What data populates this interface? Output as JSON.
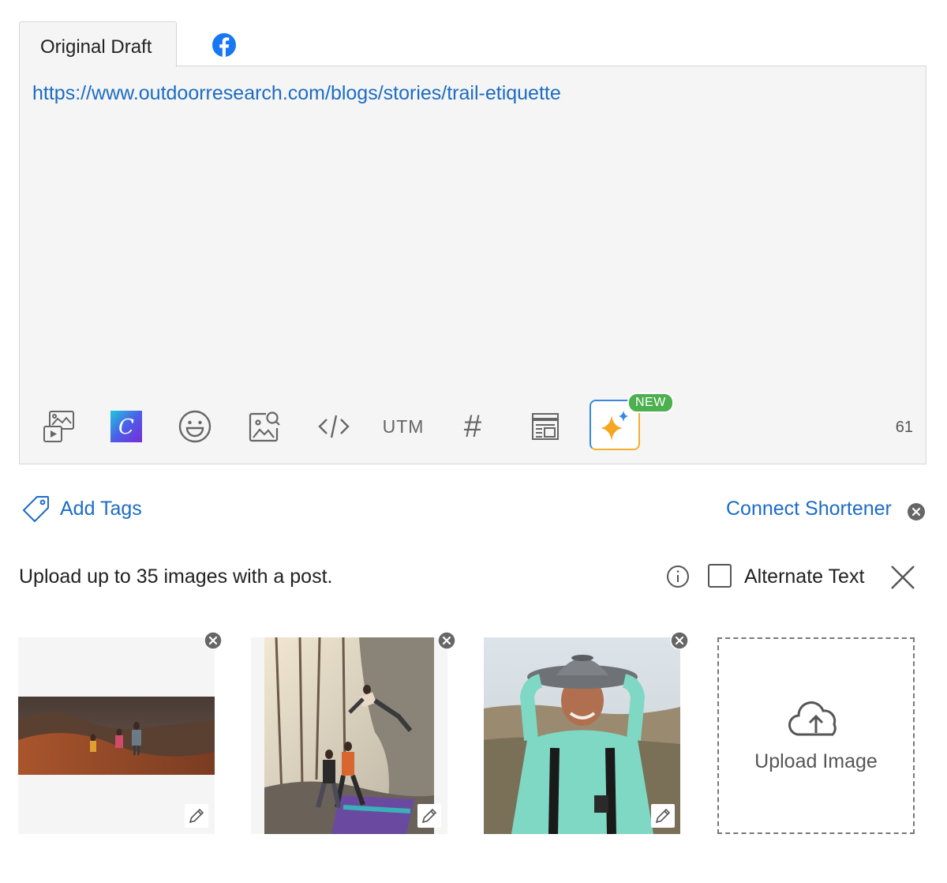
{
  "tabs": {
    "draft_label": "Original Draft",
    "network_icon": "facebook-icon"
  },
  "editor": {
    "text": "https://www.outdoorresearch.com/blogs/stories/trail-etiquette",
    "char_count": "61",
    "toolbar": {
      "utm_label": "UTM",
      "hashtag_label": "#",
      "new_badge": "NEW",
      "canva_letter": "C",
      "icons": [
        "media-library-icon",
        "canva-icon",
        "emoji-icon",
        "image-search-icon",
        "code-icon",
        "utm-button",
        "hashtag-icon",
        "layout-icon",
        "ai-sparkle-icon"
      ]
    }
  },
  "tags": {
    "add_label": "Add Tags"
  },
  "shortener": {
    "label": "Connect Shortener"
  },
  "upload": {
    "info": "Upload up to 35 images with a post.",
    "alt_text_label": "Alternate Text",
    "alt_text_checked": false,
    "dropzone_label": "Upload Image"
  },
  "colors": {
    "link": "#1d6cc4",
    "panel": "#f4f5f4",
    "badge": "#4caf50",
    "facebook": "#1877f2"
  }
}
